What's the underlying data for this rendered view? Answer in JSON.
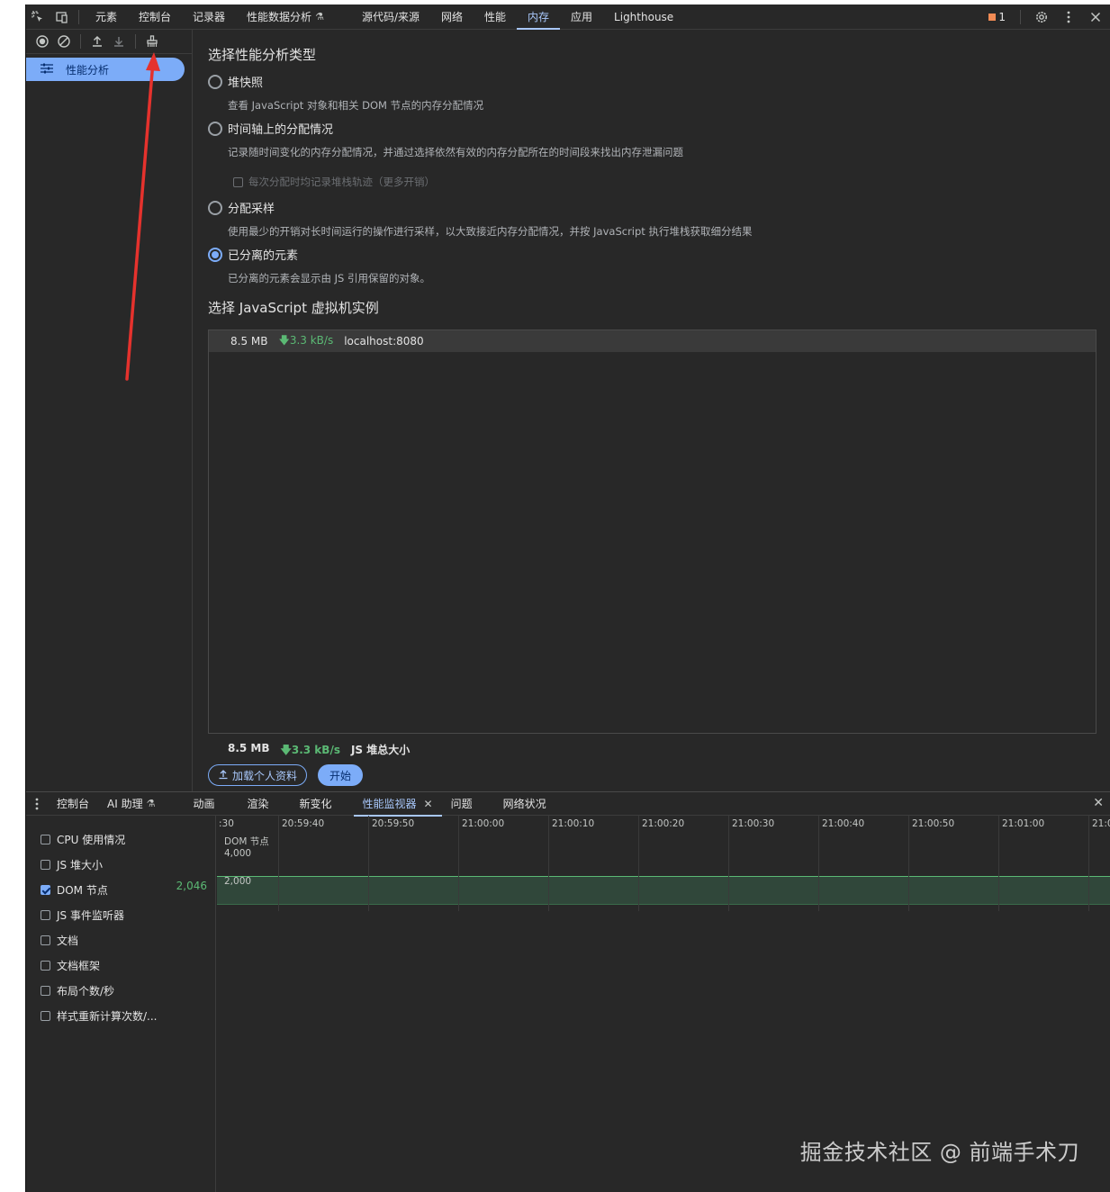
{
  "topbar": {
    "tabs": [
      {
        "label": "元素"
      },
      {
        "label": "控制台"
      },
      {
        "label": "记录器"
      },
      {
        "label": "性能数据分析"
      },
      {
        "label": "源代码/来源"
      },
      {
        "label": "网络"
      },
      {
        "label": "性能"
      },
      {
        "label": "内存"
      },
      {
        "label": "应用"
      },
      {
        "label": "Lighthouse"
      }
    ],
    "active_tab": "内存",
    "issues_count": "1"
  },
  "sidebar": {
    "item_label": "性能分析"
  },
  "main": {
    "profile_type_title": "选择性能分析类型",
    "options": [
      {
        "label": "堆快照",
        "desc": "查看 JavaScript 对象和相关 DOM 节点的内存分配情况"
      },
      {
        "label": "时间轴上的分配情况",
        "desc": "记录随时间变化的内存分配情况，并通过选择依然有效的内存分配所在的时间段来找出内存泄漏问题"
      },
      {
        "label": "分配采样",
        "desc": "使用最少的开销对长时间运行的操作进行采样，以大致接近内存分配情况，并按 JavaScript 执行堆栈获取细分结果"
      },
      {
        "label": "已分离的元素",
        "desc": "已分离的元素会显示由 JS 引用保留的对象。"
      }
    ],
    "stack_trace_option": "每次分配时均记录堆栈轨迹（更多开销）",
    "selected_option": "已分离的元素",
    "vm_title": "选择 JavaScript 虚拟机实例",
    "vm_instance": {
      "heap": "8.5 MB",
      "rate": "3.3 kB/s",
      "host": "localhost:8080"
    },
    "footer": {
      "heap": "8.5 MB",
      "rate": "3.3 kB/s",
      "label": "JS 堆总大小"
    },
    "load_button": "加载个人资料",
    "start_button": "开始"
  },
  "drawer": {
    "tabs": [
      {
        "label": "控制台"
      },
      {
        "label": "AI 助理"
      },
      {
        "label": "动画"
      },
      {
        "label": "渲染"
      },
      {
        "label": "新变化"
      },
      {
        "label": "性能监视器"
      },
      {
        "label": "问题"
      },
      {
        "label": "网络状况"
      }
    ],
    "active_tab": "性能监视器",
    "metrics": [
      {
        "label": "CPU 使用情况",
        "checked": false,
        "value": ""
      },
      {
        "label": "JS 堆大小",
        "checked": false,
        "value": ""
      },
      {
        "label": "DOM 节点",
        "checked": true,
        "value": "2,046"
      },
      {
        "label": "JS 事件监听器",
        "checked": false,
        "value": ""
      },
      {
        "label": "文档",
        "checked": false,
        "value": ""
      },
      {
        "label": "文档框架",
        "checked": false,
        "value": ""
      },
      {
        "label": "布局个数/秒",
        "checked": false,
        "value": ""
      },
      {
        "label": "样式重新计算次数/...",
        "checked": false,
        "value": ""
      }
    ],
    "graph": {
      "series_label": "DOM 节点",
      "y_ticks": [
        "4,000",
        "2,000"
      ],
      "time_labels": [
        ":30",
        "20:59:40",
        "20:59:50",
        "21:00:00",
        "21:00:10",
        "21:00:20",
        "21:00:30",
        "21:00:40",
        "21:00:50",
        "21:01:00",
        "21:0"
      ]
    }
  },
  "watermark": "掘金技术社区 @ 前端手术刀",
  "colors": {
    "background": "#282828",
    "accent": "#7cacf8",
    "green": "#5bb974",
    "annotation_arrow": "#e5322d"
  }
}
